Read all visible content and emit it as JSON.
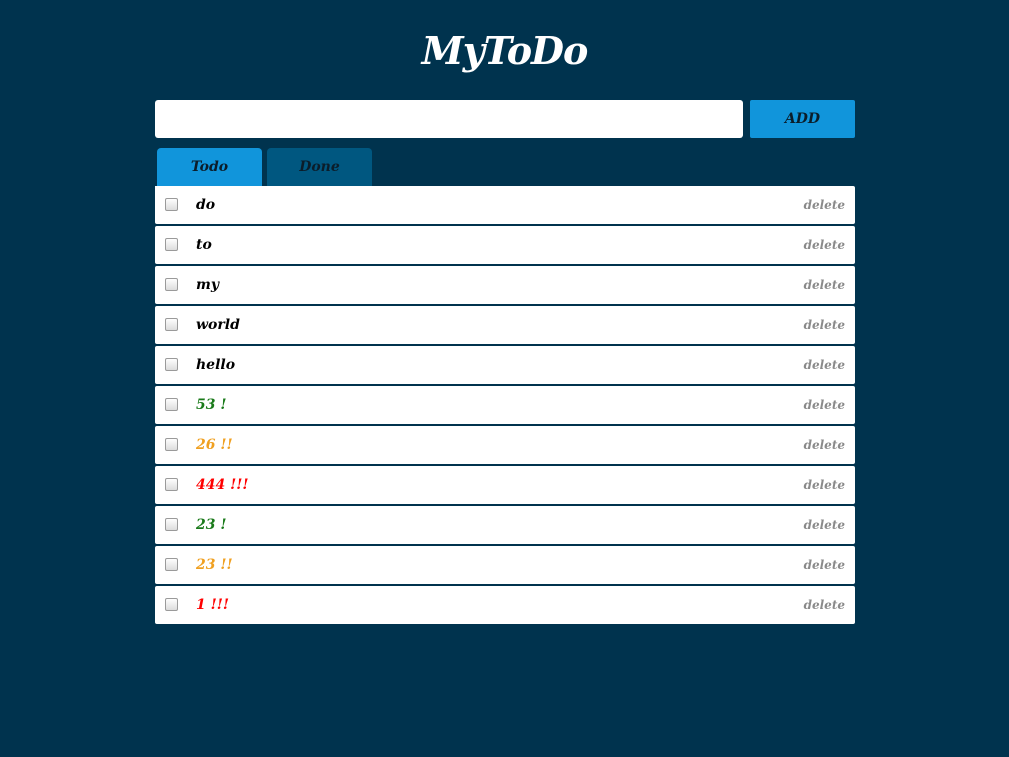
{
  "app": {
    "title": "MyToDo"
  },
  "input": {
    "value": "",
    "placeholder": ""
  },
  "add_label": "ADD",
  "tabs": [
    {
      "label": "Todo",
      "active": true
    },
    {
      "label": "Done",
      "active": false
    }
  ],
  "colors": {
    "background": "#00334e",
    "accent": "#1195db",
    "tab_inactive": "#005780",
    "priority_none": "#000000",
    "priority_low": "#1a7a1a",
    "priority_medium": "#f0a020",
    "priority_high": "#ff0000"
  },
  "tasks": [
    {
      "text": "do",
      "delete_label": "delete",
      "priority": "none",
      "checked": false
    },
    {
      "text": "to",
      "delete_label": "delete",
      "priority": "none",
      "checked": false
    },
    {
      "text": "my",
      "delete_label": "delete",
      "priority": "none",
      "checked": false
    },
    {
      "text": "world",
      "delete_label": "delete",
      "priority": "none",
      "checked": false
    },
    {
      "text": "hello",
      "delete_label": "delete",
      "priority": "none",
      "checked": false
    },
    {
      "text": "53 !",
      "delete_label": "delete",
      "priority": "low",
      "checked": false
    },
    {
      "text": "26 !!",
      "delete_label": "delete",
      "priority": "medium",
      "checked": false
    },
    {
      "text": "444 !!!",
      "delete_label": "delete",
      "priority": "high",
      "checked": false
    },
    {
      "text": "23 !",
      "delete_label": "delete",
      "priority": "low",
      "checked": false
    },
    {
      "text": "23 !!",
      "delete_label": "delete",
      "priority": "medium",
      "checked": false
    },
    {
      "text": "1 !!!",
      "delete_label": "delete",
      "priority": "high",
      "checked": false
    }
  ]
}
